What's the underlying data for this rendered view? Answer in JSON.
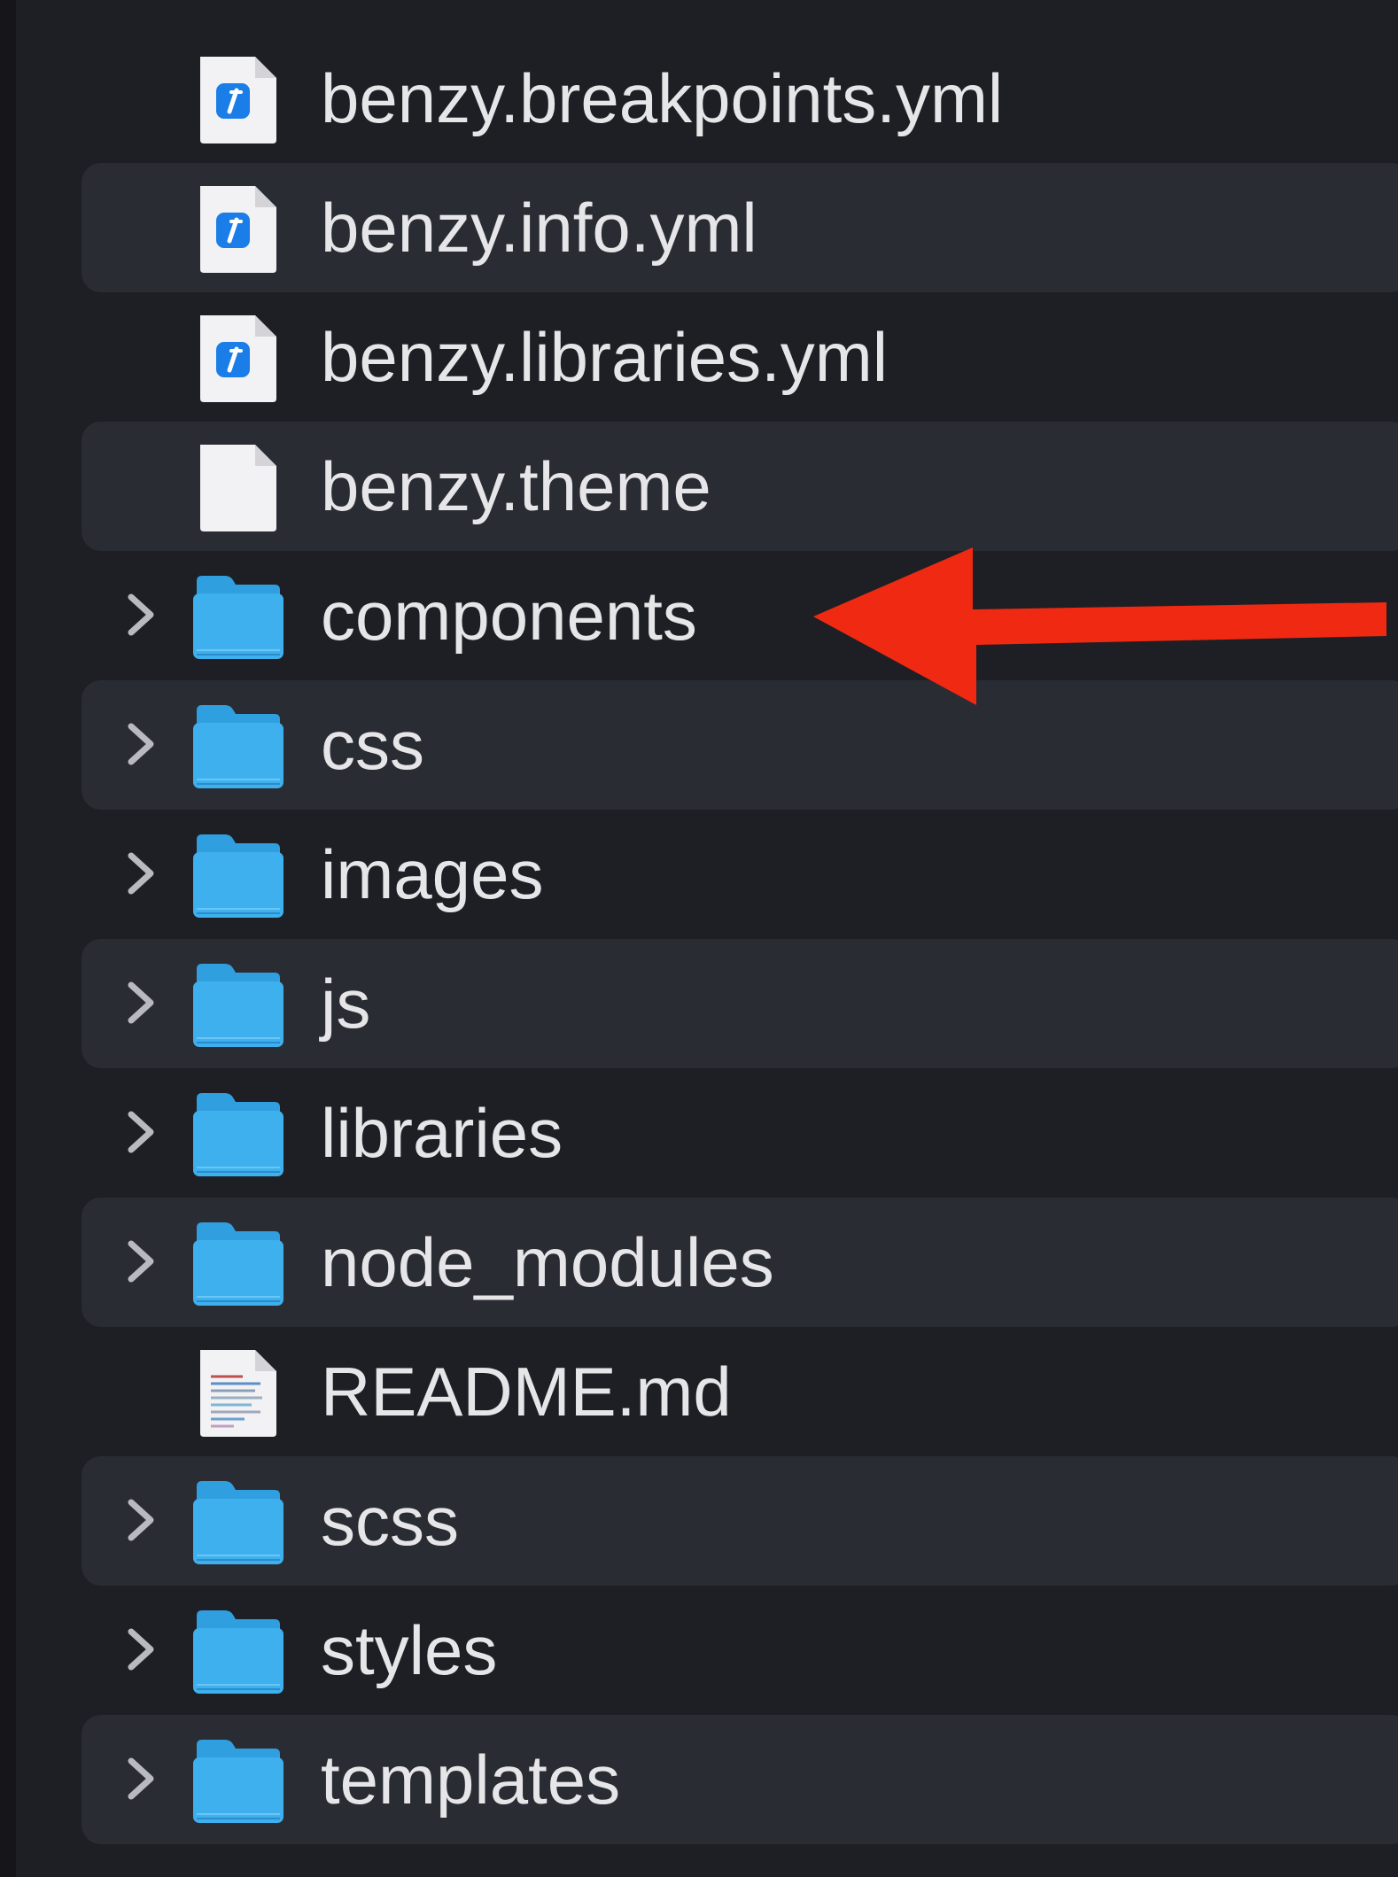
{
  "file_list": {
    "items": [
      {
        "name": "benzy.breakpoints.yml",
        "kind": "file",
        "icon": "yml-file-icon",
        "striped": false
      },
      {
        "name": "benzy.info.yml",
        "kind": "file",
        "icon": "yml-file-icon",
        "striped": true
      },
      {
        "name": "benzy.libraries.yml",
        "kind": "file",
        "icon": "yml-file-icon",
        "striped": false
      },
      {
        "name": "benzy.theme",
        "kind": "file",
        "icon": "blank-file-icon",
        "striped": true
      },
      {
        "name": "components",
        "kind": "folder",
        "icon": "folder-icon",
        "striped": false
      },
      {
        "name": "css",
        "kind": "folder",
        "icon": "folder-icon",
        "striped": true
      },
      {
        "name": "images",
        "kind": "folder",
        "icon": "folder-icon",
        "striped": false
      },
      {
        "name": "js",
        "kind": "folder",
        "icon": "folder-icon",
        "striped": true
      },
      {
        "name": "libraries",
        "kind": "folder",
        "icon": "folder-icon",
        "striped": false
      },
      {
        "name": "node_modules",
        "kind": "folder",
        "icon": "folder-icon",
        "striped": true
      },
      {
        "name": "README.md",
        "kind": "file",
        "icon": "text-document-icon",
        "striped": false
      },
      {
        "name": "scss",
        "kind": "folder",
        "icon": "folder-icon",
        "striped": true
      },
      {
        "name": "styles",
        "kind": "folder",
        "icon": "folder-icon",
        "striped": false
      },
      {
        "name": "templates",
        "kind": "folder",
        "icon": "folder-icon",
        "striped": true
      }
    ]
  },
  "annotation": {
    "icon": "red-arrow-icon",
    "points_to": "components",
    "color": "#f02a12"
  },
  "colors": {
    "background": "#1e1f24",
    "stripe": "#2a2c34",
    "text": "#e6e6e8",
    "folder": "#3eb0ee",
    "yml_badge": "#1a7de8"
  }
}
